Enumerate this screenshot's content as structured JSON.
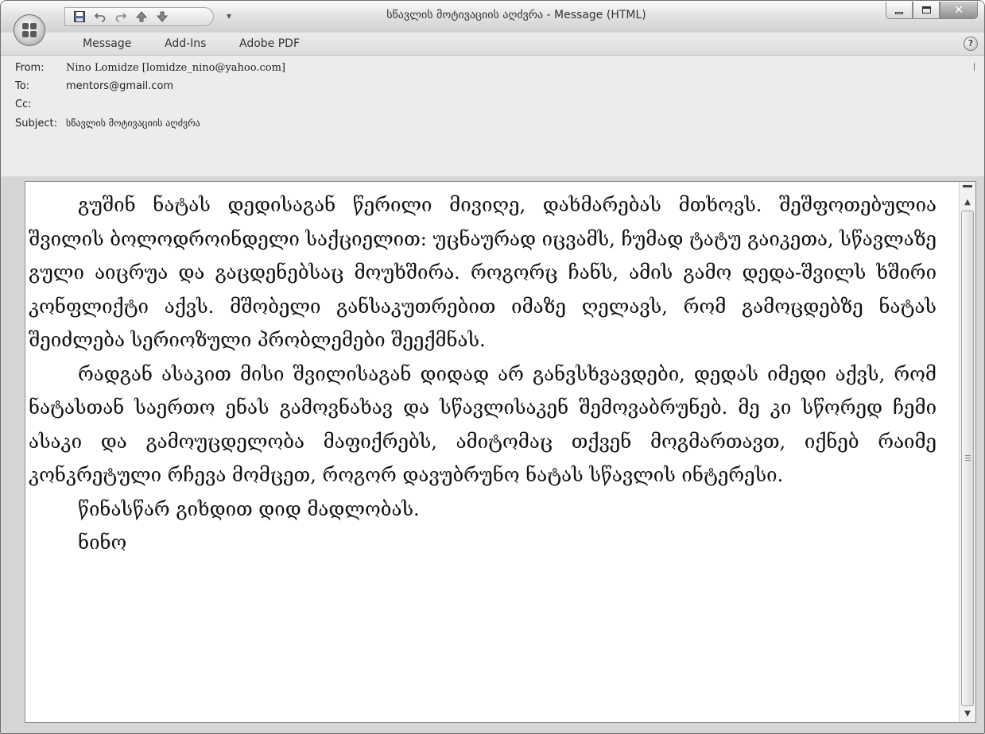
{
  "window": {
    "title": "სწავლის მოტივაციის აღძვრა - Message (HTML)"
  },
  "quick_access": {
    "icons": [
      "save-icon",
      "undo-icon",
      "redo-icon",
      "previous-item-icon",
      "next-item-icon",
      "customize-dropdown-icon"
    ]
  },
  "ribbon": {
    "tabs": [
      {
        "label": "Message"
      },
      {
        "label": "Add-Ins"
      },
      {
        "label": "Adobe PDF"
      }
    ],
    "help": "?"
  },
  "header": {
    "from_label": "From:",
    "from_value": "Nino Lomidze [lomidze_nino@yahoo.com]",
    "to_label": "To:",
    "to_value": "mentors@gmail.com",
    "cc_label": "Cc:",
    "cc_value": "",
    "subject_label": "Subject:",
    "subject_value": "სწავლის მოტივაციის აღძვრა"
  },
  "message": {
    "paragraphs": [
      "გუშინ ნატას დედისაგან წერილი მივიღე, დახმარებას მთხოვს. შეშფოთებულია შვილის ბოლოდროინდელი საქციელით: უცნაურად იცვამს, ჩუმად ტატუ გაიკეთა, სწავლაზე გული აიცრუა და გაცდენებსაც მოუხშირა. როგორც ჩანს, ამის გამო დედა-შვილს ხშირი კონფლიქტი აქვს. მშობელი განსაკუთრებით იმაზე ღელავს, რომ გამოცდებზე ნატას შეიძლება სერიოზული პრობლემები შეექმნას.",
      "რადგან ასაკით მისი შვილისაგან დიდად არ განვსხვავდები, დედას იმედი აქვს, რომ ნატასთან საერთო ენას გამოვნახავ და სწავლისაკენ შემოვაბრუნებ.  მე კი სწორედ ჩემი ასაკი და გამოუცდელობა მაფიქრებს, ამიტომაც თქვენ მოგმართავთ, იქნებ რაიმე  კონკრეტული რჩევა მომცეთ, როგორ დავუბრუნო ნატას სწავლის ინტერესი."
    ],
    "closing": "წინასწარ გიხდით დიდ მადლობას.",
    "signature": "ნინო"
  }
}
